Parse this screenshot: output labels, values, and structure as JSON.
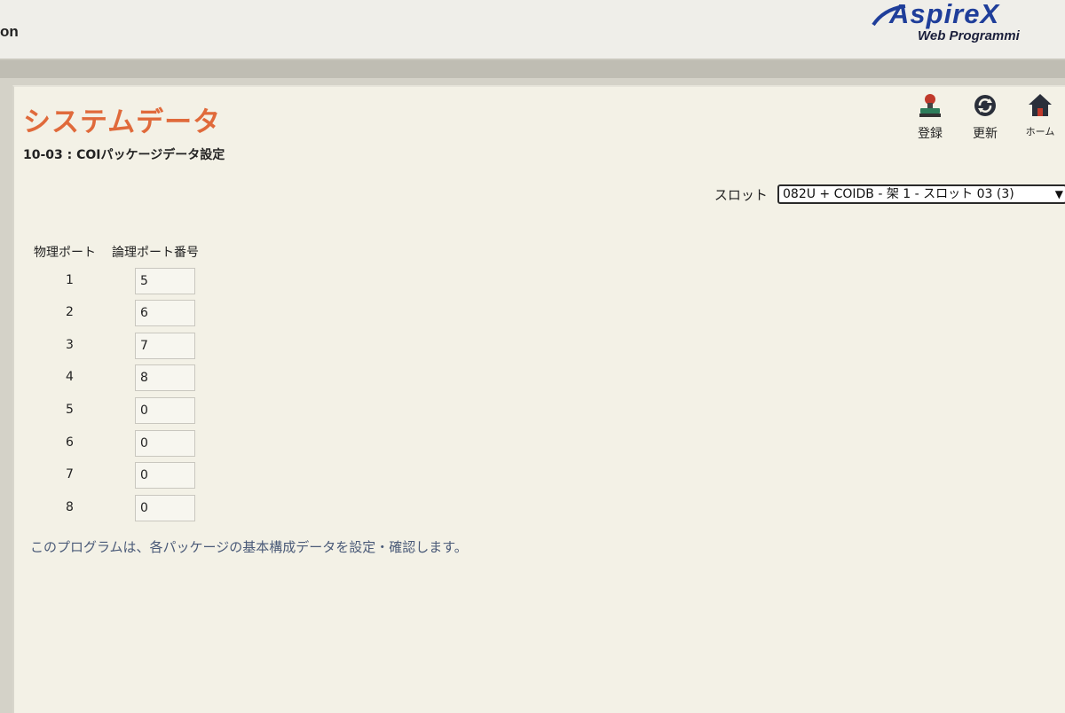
{
  "header": {
    "left_fragment": "on",
    "brand_name": "AspireX",
    "brand_subtitle": "Web Programmi"
  },
  "page": {
    "title": "システムデータ",
    "subtitle": "10-03 : COIパッケージデータ設定"
  },
  "toolbar": {
    "register_label": "登録",
    "refresh_label": "更新",
    "home_label": "ホーム"
  },
  "slot": {
    "label": "スロット",
    "selected": "082U + COIDB - 架 1 - スロット 03 (3)"
  },
  "ports": {
    "physical_header": "物理ポート",
    "logical_header": "論理ポート番号",
    "rows": [
      {
        "physical": "1",
        "logical": "5"
      },
      {
        "physical": "2",
        "logical": "6"
      },
      {
        "physical": "3",
        "logical": "7"
      },
      {
        "physical": "4",
        "logical": "8"
      },
      {
        "physical": "5",
        "logical": "0"
      },
      {
        "physical": "6",
        "logical": "0"
      },
      {
        "physical": "7",
        "logical": "0"
      },
      {
        "physical": "8",
        "logical": "0"
      }
    ]
  },
  "description": "このプログラムは、各パッケージの基本構成データを設定・確認します。",
  "colors": {
    "title_accent": "#e06a3b",
    "brand_blue": "#1f3e9a",
    "panel_background": "#f3f1e6"
  }
}
